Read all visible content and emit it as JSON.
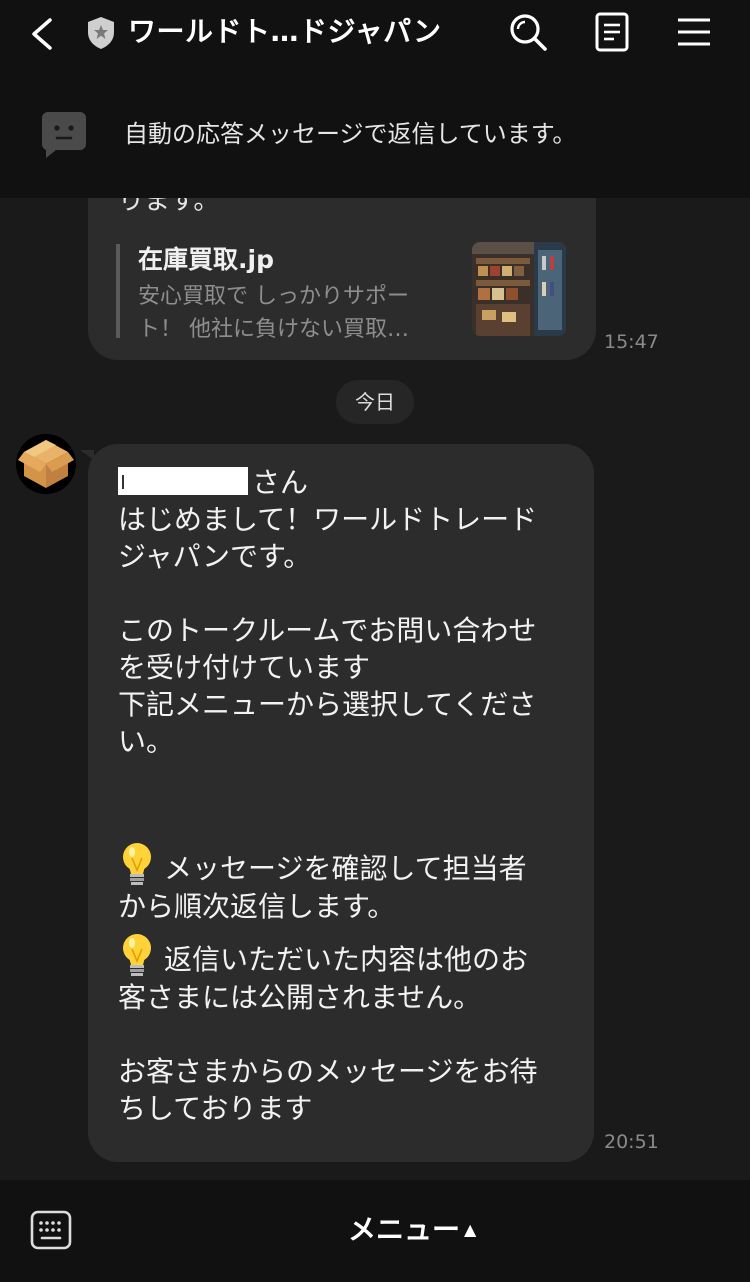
{
  "header": {
    "title": "ワールドト…ドジャパン",
    "back_icon": "chevron-left-icon",
    "verified_icon": "shield-star-icon",
    "search_icon": "search-icon",
    "notes_icon": "notes-icon",
    "menu_icon": "hamburger-icon"
  },
  "notice": {
    "text": "自動の応答メッセージで返信しています。",
    "icon": "chat-bubble-icon"
  },
  "messages": {
    "first": {
      "partial_text": "ります。",
      "preview_title": "在庫買取.jp",
      "preview_desc_line1": "安心買取で しっかりサポー",
      "preview_desc_line2": "ト！ 他社に負けない買取…",
      "time": "15:47"
    },
    "date_divider": "今日",
    "second": {
      "greeting_suffix": "さん",
      "line1": "はじめまして！ワールドトレード",
      "line2": "ジャパンです。",
      "line3": "このトークルームでお問い合わせ",
      "line4": "を受け付けています",
      "line5": "下記メニューから選択してくださ",
      "line6": "い。",
      "line7": "メッセージを確認して担当者",
      "line8": "から順次返信します。",
      "line9": "返信いただいた内容は他のお",
      "line10": "客さまには公開されません。",
      "line11": "お客さまからのメッセージをお待",
      "line12": "ちしております",
      "time": "20:51"
    }
  },
  "bottom": {
    "menu_label": "メニュー",
    "menu_arrow": "▲",
    "keyboard_icon": "keyboard-icon"
  },
  "colors": {
    "background": "#1a1a1a",
    "header": "#111111",
    "bubble": "#2c2c2c",
    "muted_text": "#8e8e8e"
  }
}
